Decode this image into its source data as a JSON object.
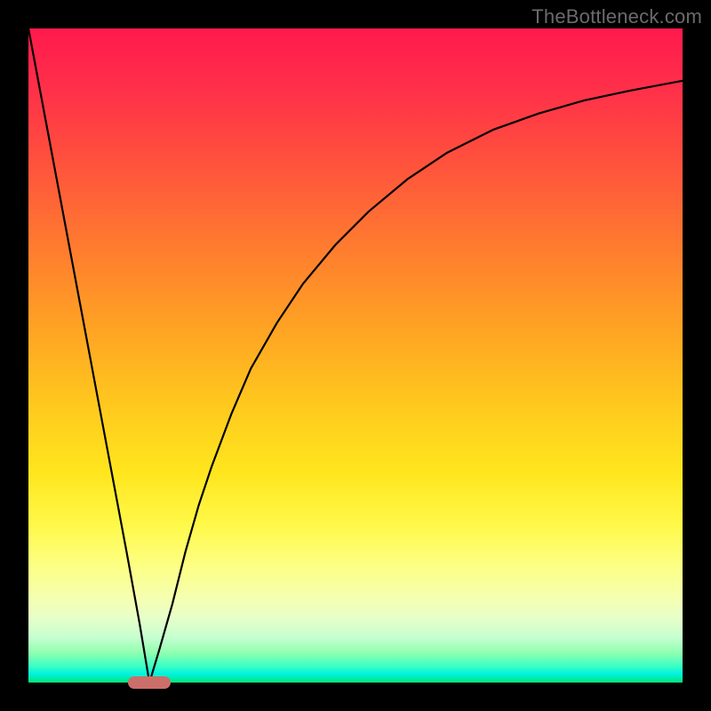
{
  "watermark": "TheBottleneck.com",
  "colors": {
    "frame": "#000000",
    "curve": "#000000",
    "marker": "#cc6e6a",
    "gradient_top": "#ff1a4d",
    "gradient_bottom": "#00e676"
  },
  "chart_data": {
    "type": "line",
    "title": "",
    "xlabel": "",
    "ylabel": "",
    "xlim": [
      0,
      100
    ],
    "ylim": [
      0,
      100
    ],
    "grid": false,
    "annotations": [
      {
        "kind": "rounded-marker",
        "x": 18.5,
        "y": 0,
        "label": "optimal-point"
      }
    ],
    "series": [
      {
        "name": "bottleneck-curve",
        "x": [
          0,
          3,
          6,
          9,
          12,
          15,
          17,
          18.5,
          20,
          22,
          24,
          26,
          28,
          31,
          34,
          38,
          42,
          47,
          52,
          58,
          64,
          71,
          78,
          85,
          92,
          100
        ],
        "y": [
          100,
          84,
          68,
          52,
          36,
          20,
          9,
          0,
          5,
          12,
          20,
          27,
          33,
          41,
          48,
          55,
          61,
          67,
          72,
          77,
          81,
          84.5,
          87,
          89,
          90.5,
          92
        ]
      }
    ],
    "background": {
      "type": "vertical-gradient",
      "meaning": "red=high bottleneck, green=low bottleneck"
    }
  }
}
